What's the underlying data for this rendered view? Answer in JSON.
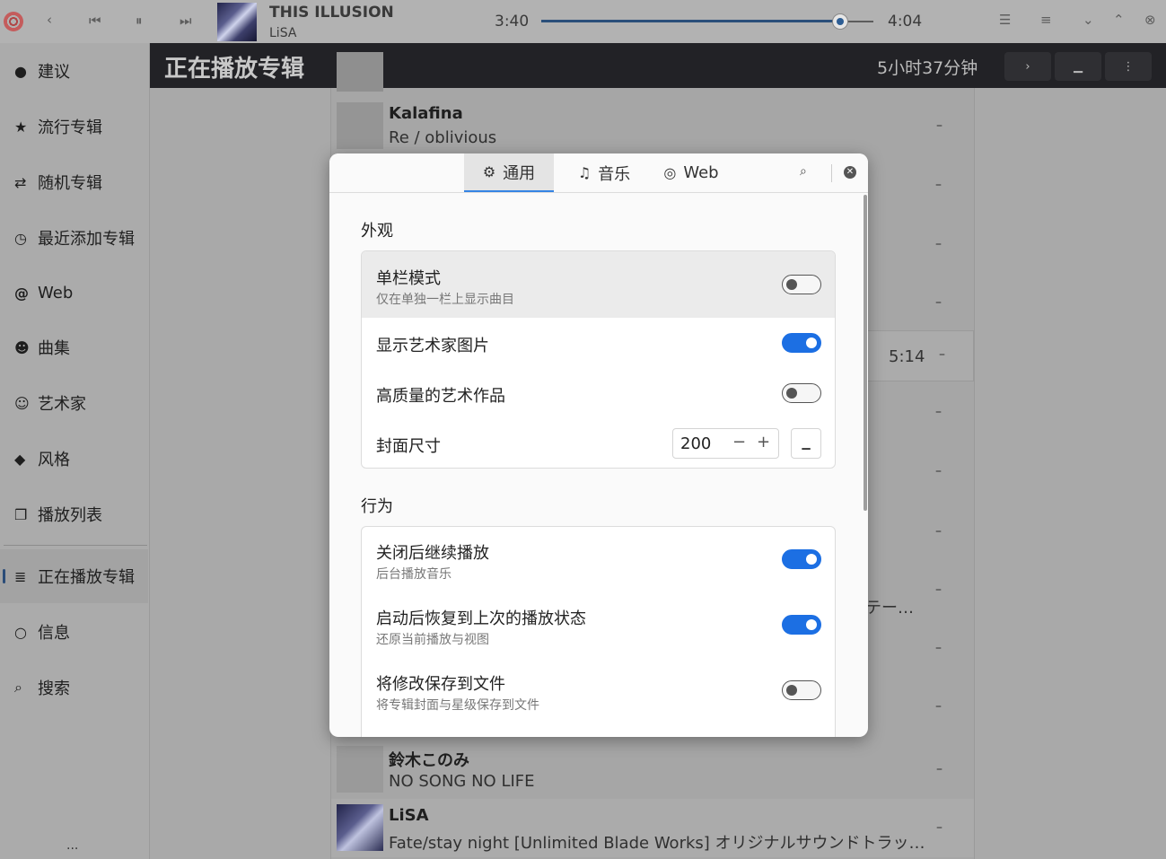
{
  "window": {
    "track_title": "THIS ILLUSION",
    "track_artist": "LiSA",
    "time_current": "3:40",
    "time_total": "4:04",
    "progress_fraction": 0.9
  },
  "sidebar": {
    "items": [
      {
        "label": "建议",
        "icon": "bulb-icon"
      },
      {
        "label": "流行专辑",
        "icon": "star-icon"
      },
      {
        "label": "随机专辑",
        "icon": "shuffle-icon"
      },
      {
        "label": "最近添加专辑",
        "icon": "clock-icon"
      },
      {
        "label": "Web",
        "icon": "at-icon"
      },
      {
        "label": "曲集",
        "icon": "people-icon"
      },
      {
        "label": "艺术家",
        "icon": "person-icon"
      },
      {
        "label": "风格",
        "icon": "tag-icon"
      },
      {
        "label": "播放列表",
        "icon": "copy-icon"
      },
      {
        "label": "正在播放专辑",
        "icon": "queue-icon"
      },
      {
        "label": "信息",
        "icon": "lightbulb-icon"
      },
      {
        "label": "搜索",
        "icon": "search-icon"
      }
    ],
    "more": "..."
  },
  "header": {
    "title": "正在播放专辑",
    "duration": "5小时37分钟"
  },
  "list": {
    "rows": [
      {
        "artist": "Kalafina",
        "album": "Re / oblivious",
        "dash": "–"
      },
      {
        "artist": "鈴木このみ",
        "album": "NO SONG NO LIFE",
        "dash": "–"
      },
      {
        "artist": "LiSA",
        "album": "Fate/stay night [Unlimited Blade Works] オリジナルサウンドトラッ…",
        "dash": "–"
      }
    ],
    "selected_duration": "5:14",
    "selected_dash": "–",
    "fragment": "テー…",
    "dash": "–"
  },
  "dialog": {
    "tabs": [
      {
        "label": "通用",
        "icon": "gear-icon"
      },
      {
        "label": "音乐",
        "icon": "music-note-icon"
      },
      {
        "label": "Web",
        "icon": "globe-icon"
      }
    ],
    "appearance": {
      "title": "外观",
      "single_column": {
        "label": "单栏模式",
        "sub": "仅在单独一栏上显示曲目",
        "on": false
      },
      "artist_images": {
        "label": "显示艺术家图片",
        "on": true
      },
      "hq_artwork": {
        "label": "高质量的艺术作品",
        "on": false
      },
      "cover_size": {
        "label": "封面尺寸",
        "value": "200",
        "minus": "−",
        "plus": "+"
      }
    },
    "behavior": {
      "title": "行为",
      "keep_playing": {
        "label": "关闭后继续播放",
        "sub": "后台播放音乐",
        "on": true
      },
      "restore_state": {
        "label": "启动后恢复到上次的播放状态",
        "sub": "还原当前播放与视图",
        "on": true
      },
      "save_to_file": {
        "label": "将修改保存到文件",
        "sub": "将专辑封面与星级保存到文件",
        "on": false
      }
    }
  }
}
